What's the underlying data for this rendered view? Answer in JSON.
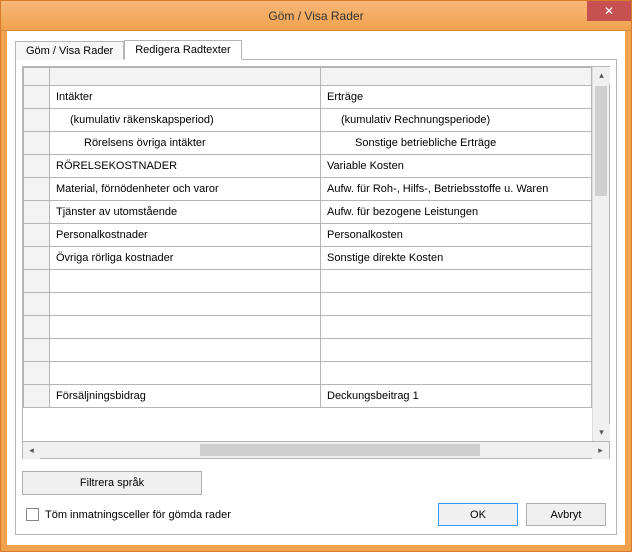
{
  "window": {
    "title": "Göm / Visa Rader"
  },
  "tabs": {
    "tab1": "Göm / Visa Rader",
    "tab2": "Redigera Radtexter"
  },
  "grid": {
    "rows": [
      {
        "left": "Intäkter",
        "right": "Erträge",
        "indent": 0
      },
      {
        "left": "(kumulativ räkenskapsperiod)",
        "right": "(kumulativ Rechnungsperiode)",
        "indent": 1
      },
      {
        "left": "Rörelsens övriga intäkter",
        "right": "Sonstige betriebliche Erträge",
        "indent": 2
      },
      {
        "left": "RÖRELSEKOSTNADER",
        "right": "Variable Kosten",
        "indent": 0
      },
      {
        "left": "Material, förnödenheter och varor",
        "right": "Aufw. für Roh-, Hilfs-, Betriebsstoffe u. Waren",
        "indent": 0
      },
      {
        "left": "Tjänster av utomstående",
        "right": "Aufw. für bezogene Leistungen",
        "indent": 0
      },
      {
        "left": "Personalkostnader",
        "right": "Personalkosten",
        "indent": 0
      },
      {
        "left": "Övriga rörliga kostnader",
        "right": "Sonstige direkte Kosten",
        "indent": 0
      },
      {
        "left": "",
        "right": "",
        "indent": 0
      },
      {
        "left": "",
        "right": "",
        "indent": 0
      },
      {
        "left": "",
        "right": "",
        "indent": 0
      },
      {
        "left": "",
        "right": "",
        "indent": 0
      },
      {
        "left": "",
        "right": "",
        "indent": 0
      },
      {
        "left": "Försäljningsbidrag",
        "right": "Deckungsbeitrag 1",
        "indent": 0
      }
    ]
  },
  "buttons": {
    "filter": "Filtrera språk",
    "ok": "OK",
    "cancel": "Avbryt"
  },
  "checkbox": {
    "label": "Töm inmatningsceller för gömda rader"
  }
}
